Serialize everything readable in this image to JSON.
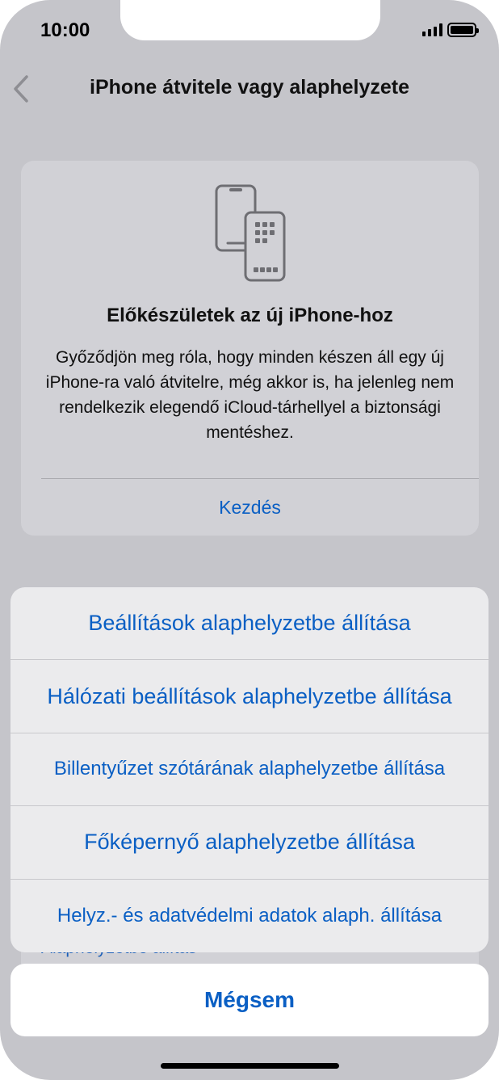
{
  "status_bar": {
    "time": "10:00"
  },
  "nav": {
    "title": "iPhone átvitele vagy alaphelyzete"
  },
  "card": {
    "title": "Előkészületek az új iPhone-hoz",
    "body": "Győződjön meg róla, hogy minden készen áll egy új iPhone-ra való átvitelre, még akkor is, ha jelenleg nem rendelkezik elegendő iCloud-tárhellyel a biztonsági mentéshez.",
    "link": "Kezdés"
  },
  "below_card": {
    "label": "Alaphelyzetbe állítás"
  },
  "action_sheet": {
    "items": [
      {
        "label": "Beállítások alaphelyzetbe állítása"
      },
      {
        "label": "Hálózati beállítások alaphelyzetbe állítása"
      },
      {
        "label": "Billentyűzet szótárának alaphelyzetbe állítása"
      },
      {
        "label": "Főképernyő alaphelyzetbe állítása"
      },
      {
        "label": "Helyz.- és adatvédelmi adatok alaph. állítása"
      }
    ],
    "cancel": "Mégsem"
  },
  "colors": {
    "accent": "#0a5fc4",
    "background": "#c5c5ca",
    "card": "#d1d1d6"
  }
}
